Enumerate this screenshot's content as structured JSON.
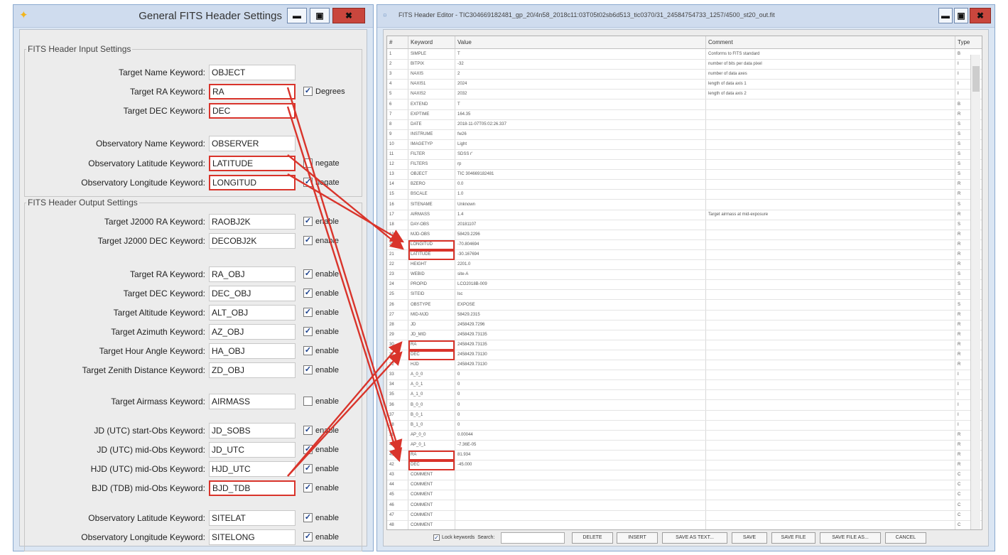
{
  "left_window": {
    "title": "General FITS Header Settings",
    "input_legend": "FITS Header Input Settings",
    "output_legend": "FITS Header Output Settings",
    "input_rows": [
      {
        "label": "Target Name Keyword:",
        "value": "OBJECT",
        "check": "",
        "checked": false,
        "hl": false
      },
      {
        "label": "Target RA Keyword:",
        "value": "RA",
        "check": "Degrees",
        "checked": true,
        "hl": true
      },
      {
        "label": "Target DEC Keyword:",
        "value": "DEC",
        "check": "",
        "checked": false,
        "hl": true
      },
      {
        "label": "Observatory Name Keyword:",
        "value": "OBSERVER",
        "check": "",
        "checked": false,
        "hl": false
      },
      {
        "label": "Observatory Latitude Keyword:",
        "value": "LATITUDE",
        "check": "negate",
        "checked": false,
        "hl": true
      },
      {
        "label": "Observatory Longitude Keyword:",
        "value": "LONGITUD",
        "check": "negate",
        "checked": true,
        "hl": true
      }
    ],
    "output_rows": [
      {
        "label": "Target J2000 RA Keyword:",
        "value": "RAOBJ2K",
        "check": "enable",
        "checked": true,
        "hl": false
      },
      {
        "label": "Target J2000 DEC Keyword:",
        "value": "DECOBJ2K",
        "check": "enable",
        "checked": true,
        "hl": false
      },
      {
        "label": "Target RA Keyword:",
        "value": "RA_OBJ",
        "check": "enable",
        "checked": true,
        "hl": false
      },
      {
        "label": "Target DEC Keyword:",
        "value": "DEC_OBJ",
        "check": "enable",
        "checked": true,
        "hl": false
      },
      {
        "label": "Target Altitude Keyword:",
        "value": "ALT_OBJ",
        "check": "enable",
        "checked": true,
        "hl": false
      },
      {
        "label": "Target Azimuth Keyword:",
        "value": "AZ_OBJ",
        "check": "enable",
        "checked": true,
        "hl": false
      },
      {
        "label": "Target Hour Angle Keyword:",
        "value": "HA_OBJ",
        "check": "enable",
        "checked": true,
        "hl": false
      },
      {
        "label": "Target Zenith Distance Keyword:",
        "value": "ZD_OBJ",
        "check": "enable",
        "checked": true,
        "hl": false
      },
      {
        "label": "Target Airmass Keyword:",
        "value": "AIRMASS",
        "check": "enable",
        "checked": false,
        "hl": false
      },
      {
        "label": "JD (UTC) start-Obs Keyword:",
        "value": "JD_SOBS",
        "check": "enable",
        "checked": true,
        "hl": false
      },
      {
        "label": "JD (UTC) mid-Obs Keyword:",
        "value": "JD_UTC",
        "check": "enable",
        "checked": true,
        "hl": false
      },
      {
        "label": "HJD (UTC) mid-Obs Keyword:",
        "value": "HJD_UTC",
        "check": "enable",
        "checked": true,
        "hl": false
      },
      {
        "label": "BJD (TDB) mid-Obs Keyword:",
        "value": "BJD_TDB",
        "check": "enable",
        "checked": true,
        "hl": true
      },
      {
        "label": "Observatory Latitude Keyword:",
        "value": "SITELAT",
        "check": "enable",
        "checked": true,
        "hl": false
      },
      {
        "label": "Observatory Longitude Keyword:",
        "value": "SITELONG",
        "check": "enable",
        "checked": true,
        "hl": false
      }
    ]
  },
  "right_window": {
    "title": "FITS Header Editor - TIC304669182481_gp_20/4n58_2018c11:03T05t02sb6d513_tic0370/31_24584754733_1257/4500_st20_out.fit",
    "columns": [
      "#",
      "Keyword",
      "Value",
      "Comment",
      "Type"
    ],
    "rows": [
      [
        "1",
        "SIMPLE",
        "T",
        "Conforms to FITS standard",
        "B"
      ],
      [
        "2",
        "BITPIX",
        "-32",
        "number of bits per data pixel",
        "I"
      ],
      [
        "3",
        "NAXIS",
        "2",
        "number of data axes",
        "I"
      ],
      [
        "4",
        "NAXIS1",
        "2024",
        "length of data axis 1",
        "I"
      ],
      [
        "5",
        "NAXIS2",
        "2032",
        "length of data axis 2",
        "I"
      ],
      [
        "6",
        "EXTEND",
        "T",
        "",
        "B"
      ],
      [
        "7",
        "EXPTIME",
        "164.35",
        "",
        "R"
      ],
      [
        "8",
        "DATE",
        "2018-11-07T05:02:26.337",
        "",
        "S"
      ],
      [
        "9",
        "INSTRUME",
        "fw26",
        "",
        "S"
      ],
      [
        "10",
        "IMAGETYP",
        "Light",
        "",
        "S"
      ],
      [
        "11",
        "FILTER",
        "SDSS r'",
        "",
        "S"
      ],
      [
        "12",
        "FILTERS",
        "rp",
        "",
        "S"
      ],
      [
        "13",
        "OBJECT",
        "TIC 304669182481",
        "",
        "S"
      ],
      [
        "14",
        "BZERO",
        "0.0",
        "",
        "R"
      ],
      [
        "15",
        "BSCALE",
        "1.0",
        "",
        "R"
      ],
      [
        "16",
        "SITENAME",
        "Unknown",
        "",
        "S"
      ],
      [
        "17",
        "AIRMASS",
        "1.4",
        "Target airmass at mid-exposure",
        "R"
      ],
      [
        "18",
        "DAY-OBS",
        "20181107",
        "",
        "S"
      ],
      [
        "19",
        "MJD-OBS",
        "58429.2296",
        "",
        "R"
      ],
      [
        "20",
        "LONGITUD",
        "-70.804694",
        "",
        "R"
      ],
      [
        "21",
        "LATITUDE",
        "-30.167694",
        "",
        "R"
      ],
      [
        "22",
        "HEIGHT",
        "2201.0",
        "",
        "R"
      ],
      [
        "23",
        "WEBID",
        "site-A",
        "",
        "S"
      ],
      [
        "24",
        "PROPID",
        "LCO2018B-009",
        "",
        "S"
      ],
      [
        "25",
        "SITEID",
        "lsc",
        "",
        "S"
      ],
      [
        "26",
        "OBSTYPE",
        "EXPOSE",
        "",
        "S"
      ],
      [
        "27",
        "MID-MJD",
        "58429.2315",
        "",
        "R"
      ],
      [
        "28",
        "JD",
        "2458429.7296",
        "",
        "R"
      ],
      [
        "29",
        "JD_MID",
        "2458429.73135",
        "",
        "R"
      ],
      [
        "30",
        "RA",
        "2458429.73135",
        "",
        "R"
      ],
      [
        "31",
        "DEC",
        "2458429.73130",
        "",
        "R"
      ],
      [
        "32",
        "HJD",
        "2458429.73130",
        "",
        "R"
      ],
      [
        "33",
        "A_0_0",
        "0",
        "",
        "I"
      ],
      [
        "34",
        "A_0_1",
        "0",
        "",
        "I"
      ],
      [
        "35",
        "A_1_0",
        "0",
        "",
        "I"
      ],
      [
        "36",
        "B_0_0",
        "0",
        "",
        "I"
      ],
      [
        "37",
        "B_0_1",
        "0",
        "",
        "I"
      ],
      [
        "38",
        "B_1_0",
        "0",
        "",
        "I"
      ],
      [
        "39",
        "AP_0_0",
        "0.00044",
        "",
        "R"
      ],
      [
        "40",
        "AP_0_1",
        "-7.36E-05",
        "",
        "R"
      ],
      [
        "41",
        "RA",
        "81.934",
        "",
        "R"
      ],
      [
        "42",
        "DEC",
        "-45.000",
        "",
        "R"
      ],
      [
        "43",
        "COMMENT",
        "",
        "",
        "C"
      ],
      [
        "44",
        "COMMENT",
        "",
        "",
        "C"
      ],
      [
        "45",
        "COMMENT",
        "",
        "",
        "C"
      ],
      [
        "46",
        "COMMENT",
        "",
        "",
        "C"
      ],
      [
        "47",
        "COMMENT",
        "",
        "",
        "C"
      ],
      [
        "48",
        "COMMENT",
        "",
        "",
        "C"
      ]
    ],
    "footer": {
      "lock_label": "Lock keywords",
      "search_label": "Search:",
      "buttons": [
        "DELETE",
        "INSERT",
        "SAVE AS TEXT...",
        "SAVE",
        "SAVE FILE",
        "SAVE FILE AS...",
        "CANCEL"
      ]
    }
  }
}
